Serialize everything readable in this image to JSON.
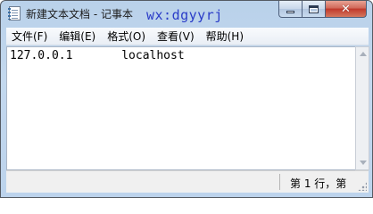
{
  "window": {
    "title": "新建文本文档 - 记事本",
    "watermark": "wx:dgyyrj"
  },
  "controls": {
    "minimize_icon": "minimize-icon",
    "maximize_icon": "maximize-icon",
    "close_icon": "close-icon",
    "close_glyph": "✕"
  },
  "menu": [
    {
      "label": "文件(F)"
    },
    {
      "label": "编辑(E)"
    },
    {
      "label": "格式(O)"
    },
    {
      "label": "查看(V)"
    },
    {
      "label": "帮助(H)"
    }
  ],
  "editor": {
    "content": "127.0.0.1       localhost"
  },
  "status": {
    "position": "第 1 行，第"
  },
  "colors": {
    "title_bar": "#b9d1ea",
    "watermark": "#2a3cc8",
    "close_button": "#c0392b"
  }
}
